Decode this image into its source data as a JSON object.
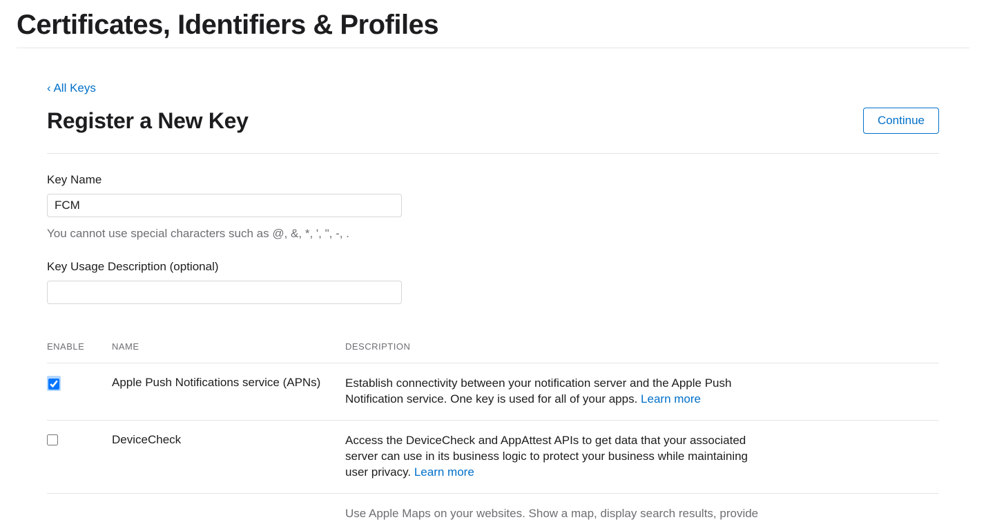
{
  "page": {
    "title": "Certificates, Identifiers & Profiles"
  },
  "breadcrumb": {
    "back_label": "All Keys"
  },
  "header": {
    "section_title": "Register a New Key",
    "continue_label": "Continue"
  },
  "form": {
    "key_name_label": "Key Name",
    "key_name_value": "FCM",
    "key_name_help": "You cannot use special characters such as @, &, *, ', \", -, .",
    "key_usage_label": "Key Usage Description (optional)",
    "key_usage_value": ""
  },
  "table": {
    "headers": {
      "enable": "ENABLE",
      "name": "NAME",
      "description": "DESCRIPTION"
    },
    "learn_more_label": "Learn more",
    "rows": [
      {
        "enabled": true,
        "name": "Apple Push Notifications service (APNs)",
        "description": "Establish connectivity between your notification server and the Apple Push Notification service. One key is used for all of your apps."
      },
      {
        "enabled": false,
        "name": "DeviceCheck",
        "description": "Access the DeviceCheck and AppAttest APIs to get data that your associated server can use in its business logic to protect your business while maintaining user privacy."
      }
    ],
    "truncated_row_description": "Use Apple Maps on your websites. Show a map, display search results, provide"
  }
}
